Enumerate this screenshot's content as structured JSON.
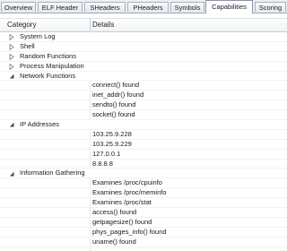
{
  "tabs": [
    {
      "label": "Overview",
      "active": false
    },
    {
      "label": "ELF Header",
      "active": false
    },
    {
      "label": "SHeaders",
      "active": false
    },
    {
      "label": "PHeaders",
      "active": false
    },
    {
      "label": "Symbols",
      "active": false
    },
    {
      "label": "Capabilities",
      "active": true
    },
    {
      "label": "Scoring",
      "active": false
    }
  ],
  "table": {
    "columns": {
      "category": "Category",
      "details": "Details"
    },
    "rows": [
      {
        "type": "group",
        "category": "System Log",
        "expanded": false
      },
      {
        "type": "group",
        "category": "Shell",
        "expanded": false
      },
      {
        "type": "group",
        "category": "Random Functions",
        "expanded": false
      },
      {
        "type": "group",
        "category": "Process Manipulation",
        "expanded": false
      },
      {
        "type": "group",
        "category": "Network Functions",
        "expanded": true
      },
      {
        "type": "item",
        "details": "connect() found"
      },
      {
        "type": "item",
        "details": "inet_addr() found"
      },
      {
        "type": "item",
        "details": "sendto() found"
      },
      {
        "type": "item",
        "details": "socket() found"
      },
      {
        "type": "group",
        "category": "IP Addresses",
        "expanded": true
      },
      {
        "type": "item",
        "details": "103.25.9.228"
      },
      {
        "type": "item",
        "details": "103.25.9.229"
      },
      {
        "type": "item",
        "details": "127.0.0.1"
      },
      {
        "type": "item",
        "details": "8.8.8.8"
      },
      {
        "type": "group",
        "category": "Information Gathering",
        "expanded": true
      },
      {
        "type": "item",
        "details": "Examines /proc/cpuinfo"
      },
      {
        "type": "item",
        "details": "Examines /proc/meminfo"
      },
      {
        "type": "item",
        "details": "Examines /proc/stat"
      },
      {
        "type": "item",
        "details": "access() found"
      },
      {
        "type": "item",
        "details": "getpagesize() found"
      },
      {
        "type": "item",
        "details": "phys_pages_info() found"
      },
      {
        "type": "item",
        "details": "uname() found"
      }
    ]
  }
}
